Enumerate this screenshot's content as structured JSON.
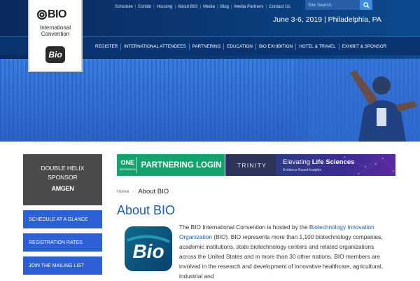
{
  "header": {
    "top_links": [
      "Schedule",
      "Exhibit",
      "Housing",
      "About BIO",
      "Media",
      "Blog",
      "Media Partners",
      "Contact Us"
    ],
    "search_placeholder": "Site Search",
    "event_date": "June 3-6, 2019 | Philadelphia, PA",
    "main_nav": [
      "REGISTER",
      "INTERNATIONAL ATTENDEES",
      "PARTNERING",
      "EDUCATION",
      "BIO EXHIBITION",
      "HOTEL & TRAVEL",
      "EXHIBIT & SPONSOR"
    ]
  },
  "logo": {
    "wordmark": "BIO",
    "line1": "International",
    "line2": "Convention",
    "badge": "Bio"
  },
  "sidebar": {
    "sponsor_title_line1": "DOUBLE HELIX",
    "sponsor_title_line2": "SPONSOR",
    "sponsor_name": "AMGEN",
    "buttons": [
      "SCHEDULE AT A GLANCE",
      "REGISTRATION RATES",
      "JOIN THE MAILING LIST"
    ]
  },
  "banners": {
    "partnering_badge": "ONE",
    "partnering_badge_sub": "PARTNERING",
    "partnering_text": "PARTNERING LOGIN →",
    "trinity": "TRINITY",
    "trinity_tagline_a": "Elevating ",
    "trinity_tagline_b": "Life Sciences",
    "trinity_sub": "Evidence-Based Insights"
  },
  "breadcrumb": {
    "home": "Home",
    "current": "About BIO"
  },
  "page": {
    "title": "About BIO",
    "bio_logo_text": "Bio",
    "paragraph_part1": "The BIO International Convention is hosted by the ",
    "paragraph_link": "Biotechnology Innovation Organization",
    "paragraph_part2": " (BIO). BIO represents more than 1,100 biotechnology companies, academic institutions, state biotechnology centers and related organizations across the United States and in more than 30 other nations. BIO members are involved in the research and development of innovative healthcare, agricultural, industrial and"
  },
  "colors": {
    "header_bg": "#0b3a78",
    "hero_blue": "#2f6fd6",
    "sidebar_button": "#2c60d4",
    "sponsor_bg": "#4a4a4a",
    "partnering_green": "#12a46c",
    "title_blue": "#1d5aa8"
  },
  "icons": {
    "search": "search-icon",
    "logo_dots": "bio-dot-icon"
  }
}
